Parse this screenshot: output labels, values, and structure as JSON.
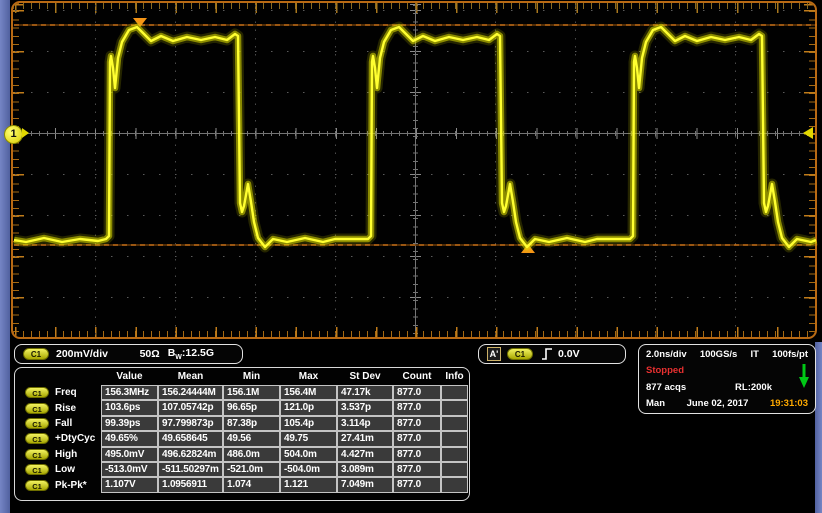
{
  "channel_readout": {
    "channel": "C1",
    "scale": "200mV/div",
    "termination": "50Ω",
    "bandwidth_base": "B",
    "bandwidth_sub": "W",
    "bandwidth_value": ":12.5G"
  },
  "trigger_readout": {
    "source_badge": "A'",
    "channel": "C1",
    "level": "0.0V"
  },
  "acquisition": {
    "timebase": "2.0ns/div",
    "sample_rate": "100GS/s",
    "acq_mode": "IT",
    "resolution": "100fs/pt",
    "status": "Stopped",
    "acq_count": "877 acqs",
    "record_length": "RL:200k",
    "trigger_mode": "Man",
    "date": "June 02, 2017",
    "time": "19:31:03"
  },
  "graticule": {
    "channel_marker": "1"
  },
  "measurements": {
    "headers": [
      "Value",
      "Mean",
      "Min",
      "Max",
      "St Dev",
      "Count",
      "Info"
    ],
    "rows": [
      {
        "source": "C1",
        "name": "Freq",
        "value": "156.3MHz",
        "mean": "156.24444M",
        "min": "156.1M",
        "max": "156.4M",
        "stdev": "47.17k",
        "count": "877.0",
        "info": ""
      },
      {
        "source": "C1",
        "name": "Rise",
        "value": "103.6ps",
        "mean": "107.05742p",
        "min": "96.65p",
        "max": "121.0p",
        "stdev": "3.537p",
        "count": "877.0",
        "info": ""
      },
      {
        "source": "C1",
        "name": "Fall",
        "value": "99.39ps",
        "mean": "97.799873p",
        "min": "87.38p",
        "max": "105.4p",
        "stdev": "3.114p",
        "count": "877.0",
        "info": ""
      },
      {
        "source": "C1",
        "name": "+DtyCyc",
        "value": "49.65%",
        "mean": "49.658645",
        "min": "49.56",
        "max": "49.75",
        "stdev": "27.41m",
        "count": "877.0",
        "info": ""
      },
      {
        "source": "C1",
        "name": "High",
        "value": "495.0mV",
        "mean": "496.62824m",
        "min": "486.0m",
        "max": "504.0m",
        "stdev": "4.427m",
        "count": "877.0",
        "info": ""
      },
      {
        "source": "C1",
        "name": "Low",
        "value": "-513.0mV",
        "mean": "-511.50297m",
        "min": "-521.0m",
        "max": "-504.0m",
        "stdev": "3.089m",
        "count": "877.0",
        "info": ""
      },
      {
        "source": "C1",
        "name": "Pk-Pk*",
        "value": "1.107V",
        "mean": "1.0956911",
        "min": "1.074",
        "max": "1.121",
        "stdev": "7.049m",
        "count": "877.0",
        "info": ""
      }
    ]
  },
  "colors": {
    "trace": "#ffff00",
    "accent_orange": "#f08018",
    "status_red": "#e83030",
    "time_orange": "#ffaa00",
    "frame_blue": "#5c6fb2"
  }
}
